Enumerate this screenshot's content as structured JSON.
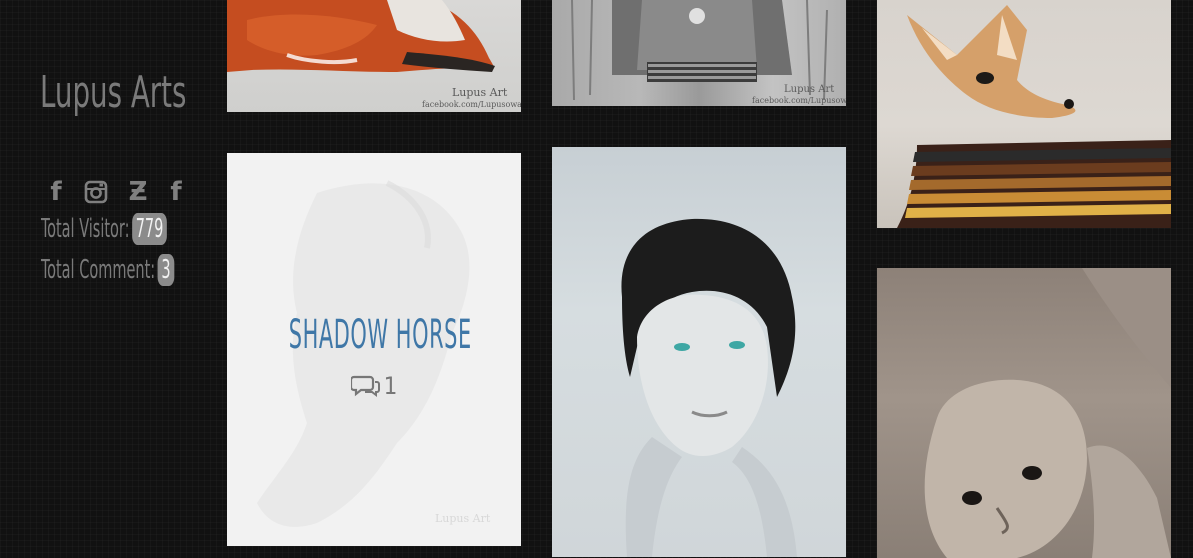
{
  "site": {
    "title": "Lupus Arts"
  },
  "social": [
    {
      "name": "facebook",
      "glyph": "f"
    },
    {
      "name": "instagram",
      "glyph": ""
    },
    {
      "name": "deviantart",
      "glyph": "Ƶ"
    },
    {
      "name": "facebook",
      "glyph": "f"
    }
  ],
  "stats": {
    "visitor_label": "Total Visitor:",
    "visitor_count": "779",
    "comment_label": "Total Comment:",
    "comment_count": "3"
  },
  "gallery": {
    "fox": {
      "signature": "Lupus Art",
      "signature_url": "facebook.com/LupusowaArt"
    },
    "geralt": {
      "signature": "Lupus Art",
      "signature_url": "facebook.com/LupusowaArt"
    },
    "horse": {
      "title": "SHADOW HORSE",
      "comment_count": "1",
      "signature": "Lupus Art"
    }
  },
  "colors": {
    "background": "#111111",
    "sidebar_text": "#7a7a7a",
    "badge": "#8b8b8b",
    "accent_title": "#3f77a7"
  },
  "icons": {
    "comment": "comments-icon"
  }
}
